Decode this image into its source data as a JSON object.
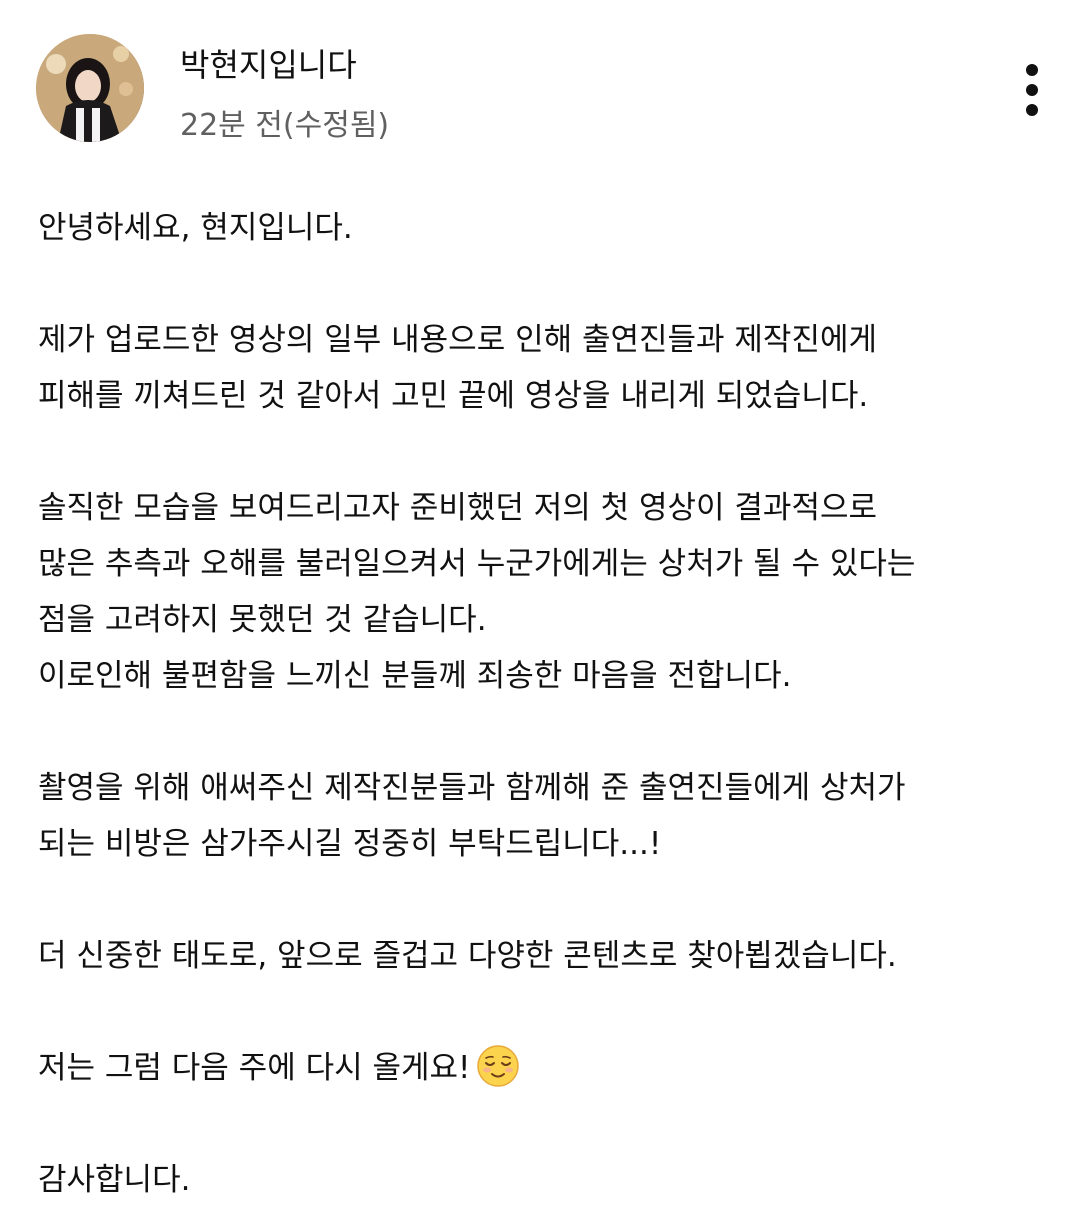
{
  "post": {
    "author": "박현지입니다",
    "time": "22분 전(수정됨)"
  },
  "icons": {
    "more": "more-vertical-icon",
    "emoji": "relieved-face-emoji"
  },
  "body": {
    "p1": "안녕하세요, 현지입니다.",
    "p2_l1": "제가 업로드한 영상의 일부 내용으로 인해 출연진들과 제작진에게",
    "p2_l2": "피해를 끼쳐드린 것 같아서 고민 끝에 영상을 내리게 되었습니다.",
    "p3_l1": "솔직한 모습을 보여드리고자 준비했던 저의 첫 영상이 결과적으로",
    "p3_l2": "많은 추측과 오해를 불러일으켜서 누군가에게는 상처가 될 수 있다는",
    "p3_l3": "점을 고려하지 못했던 것 같습니다.",
    "p3_l4": "이로인해 불편함을 느끼신 분들께 죄송한 마음을 전합니다.",
    "p4_l1": "촬영을 위해 애써주신 제작진분들과 함께해 준 출연진들에게 상처가",
    "p4_l2": "되는 비방은 삼가주시길 정중히 부탁드립니다...!",
    "p5": "더 신중한 태도로, 앞으로 즐겁고 다양한 콘텐츠로 찾아뵙겠습니다.",
    "p6": "저는 그럼 다음 주에 다시 올게요!",
    "p7": "감사합니다."
  }
}
